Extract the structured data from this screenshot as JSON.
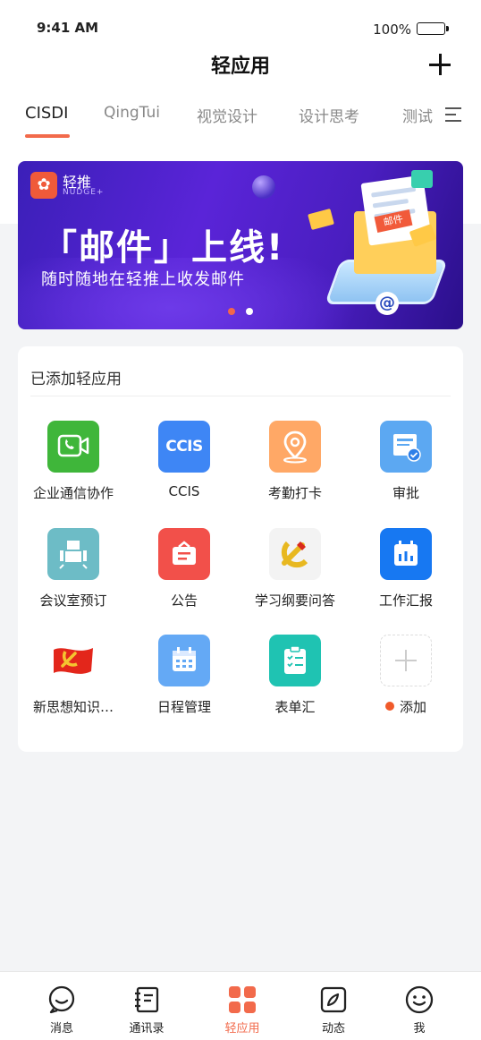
{
  "status": {
    "time": "9:41 AM",
    "battery": "100%"
  },
  "header": {
    "title": "轻应用"
  },
  "tabs": [
    {
      "label": "CISDI",
      "active": true
    },
    {
      "label": "QingTui"
    },
    {
      "label": "视觉设计"
    },
    {
      "label": "设计思考"
    },
    {
      "label": "测试"
    }
  ],
  "banner": {
    "brand": "轻推",
    "brand_sub": "NUDGE+",
    "headline": "「邮件」上线!",
    "subline": "随时随地在轻推上收发邮件",
    "tag": "邮件",
    "at_symbol": "@"
  },
  "apps_section": {
    "title": "已添加轻应用",
    "apps": [
      {
        "label": "企业通信协作",
        "icon": "video-chat-icon",
        "color": "#3fb63a"
      },
      {
        "label": "CCIS",
        "icon": "ccis-icon",
        "color": "#3e86f5",
        "icon_text": "CCIS"
      },
      {
        "label": "考勤打卡",
        "icon": "location-pin-icon",
        "color": "#ffa866"
      },
      {
        "label": "审批",
        "icon": "approval-doc-icon",
        "color": "#5ca8f2"
      },
      {
        "label": "会议室预订",
        "icon": "meeting-room-icon",
        "color": "#6dbcc6"
      },
      {
        "label": "公告",
        "icon": "announcement-icon",
        "color": "#f2504a"
      },
      {
        "label": "学习纲要问答",
        "icon": "party-emblem-icon",
        "color": "#f3f3f3"
      },
      {
        "label": "工作汇报",
        "icon": "calendar-chart-icon",
        "color": "#1778f2"
      },
      {
        "label": "新思想知识…",
        "icon": "party-flag-icon",
        "color": "#ffffff"
      },
      {
        "label": "日程管理",
        "icon": "schedule-calendar-icon",
        "color": "#64a9f5"
      },
      {
        "label": "表单汇",
        "icon": "form-clipboard-icon",
        "color": "#1fc3b2"
      },
      {
        "label": "添加",
        "icon": "add-icon",
        "color": "#ffffff"
      }
    ]
  },
  "bottom_nav": [
    {
      "label": "消息",
      "icon": "message-icon"
    },
    {
      "label": "通讯录",
      "icon": "contacts-icon"
    },
    {
      "label": "轻应用",
      "icon": "apps-grid-icon",
      "active": true
    },
    {
      "label": "动态",
      "icon": "compass-icon"
    },
    {
      "label": "我",
      "icon": "profile-face-icon"
    }
  ],
  "colors": {
    "accent": "#f26a4b",
    "background": "#f3f4f6"
  }
}
